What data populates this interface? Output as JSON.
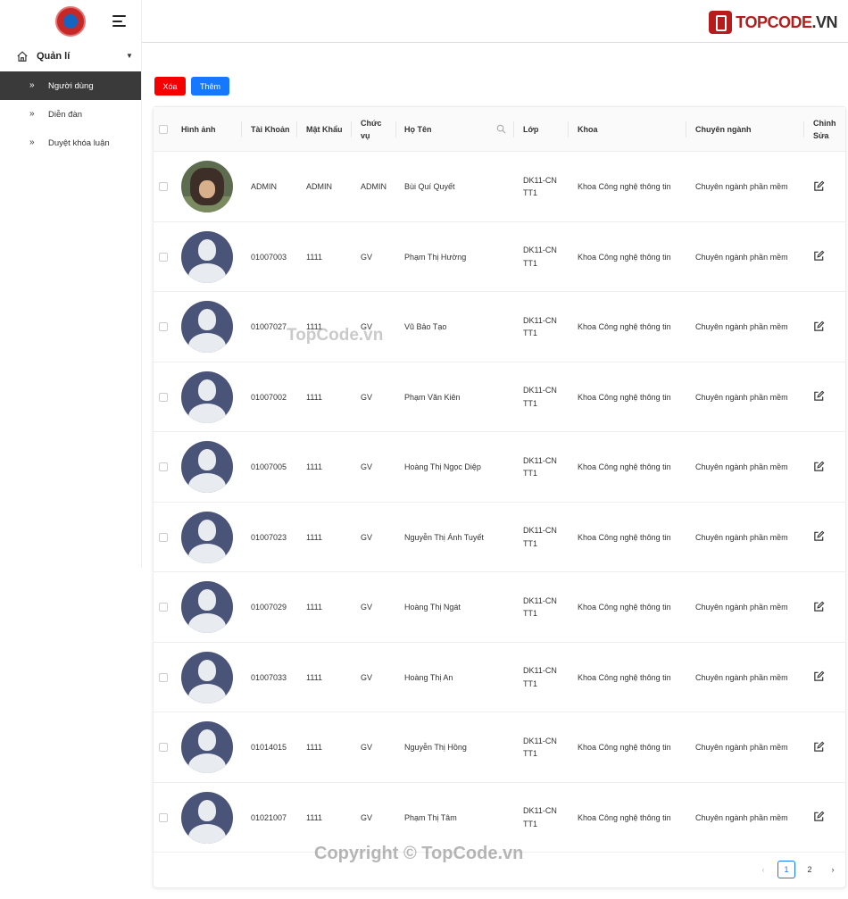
{
  "sidebar": {
    "group_label": "Quản lí",
    "items": [
      {
        "label": "Người dùng",
        "active": true
      },
      {
        "label": "Diễn đàn",
        "active": false
      },
      {
        "label": "Duyệt khóa luận",
        "active": false
      }
    ]
  },
  "brand": {
    "name": "TOPCODE",
    "suffix": ".VN"
  },
  "toolbar": {
    "delete_label": "Xóa",
    "add_label": "Thêm"
  },
  "table": {
    "headers": [
      "Hình ảnh",
      "Tài Khoản",
      "Mật Khẩu",
      "Chức vụ",
      "Họ Tên",
      "Lớp",
      "Khoa",
      "Chuyên ngành",
      "Chỉnh Sửa"
    ],
    "rows": [
      {
        "avatar": "photo",
        "account": "ADMIN",
        "password": "ADMIN",
        "role": "ADMIN",
        "name": "Bùi Quí Quyết",
        "class": "DK11-CNTT1",
        "faculty": "Khoa Công nghệ thông tin",
        "major": "Chuyên ngành phần mềm"
      },
      {
        "avatar": "default",
        "account": "01007003",
        "password": "1111",
        "role": "GV",
        "name": "Phạm Thị Hường",
        "class": "DK11-CNTT1",
        "faculty": "Khoa Công nghệ thông tin",
        "major": "Chuyên ngành phần mềm"
      },
      {
        "avatar": "default",
        "account": "01007027",
        "password": "1111",
        "role": "GV",
        "name": "Vũ Bảo Tạo",
        "class": "DK11-CNTT1",
        "faculty": "Khoa Công nghệ thông tin",
        "major": "Chuyên ngành phần mềm"
      },
      {
        "avatar": "default",
        "account": "01007002",
        "password": "1111",
        "role": "GV",
        "name": "Phạm Văn Kiên",
        "class": "DK11-CNTT1",
        "faculty": "Khoa Công nghệ thông tin",
        "major": "Chuyên ngành phần mềm"
      },
      {
        "avatar": "default",
        "account": "01007005",
        "password": "1111",
        "role": "GV",
        "name": "Hoàng Thị Ngọc Diệp",
        "class": "DK11-CNTT1",
        "faculty": "Khoa Công nghệ thông tin",
        "major": "Chuyên ngành phần mềm"
      },
      {
        "avatar": "default",
        "account": "01007023",
        "password": "1111",
        "role": "GV",
        "name": "Nguyễn Thị Ánh Tuyết",
        "class": "DK11-CNTT1",
        "faculty": "Khoa Công nghệ thông tin",
        "major": "Chuyên ngành phần mềm"
      },
      {
        "avatar": "default",
        "account": "01007029",
        "password": "1111",
        "role": "GV",
        "name": "Hoàng Thị Ngát",
        "class": "DK11-CNTT1",
        "faculty": "Khoa Công nghệ thông tin",
        "major": "Chuyên ngành phần mềm"
      },
      {
        "avatar": "default",
        "account": "01007033",
        "password": "1111",
        "role": "GV",
        "name": "Hoàng Thị An",
        "class": "DK11-CNTT1",
        "faculty": "Khoa Công nghệ thông tin",
        "major": "Chuyên ngành phần mềm"
      },
      {
        "avatar": "default",
        "account": "01014015",
        "password": "1111",
        "role": "GV",
        "name": "Nguyễn Thị Hồng",
        "class": "DK11-CNTT1",
        "faculty": "Khoa Công nghệ thông tin",
        "major": "Chuyên ngành phần mềm"
      },
      {
        "avatar": "default",
        "account": "01021007",
        "password": "1111",
        "role": "GV",
        "name": "Phạm Thị Tâm",
        "class": "DK11-CNTT1",
        "faculty": "Khoa Công nghệ thông tin",
        "major": "Chuyên ngành phần mềm"
      }
    ]
  },
  "pagination": {
    "pages": [
      "1",
      "2"
    ],
    "current": "1"
  },
  "watermarks": {
    "mid": "TopCode.vn",
    "bottom": "Copyright © TopCode.vn"
  },
  "colors": {
    "danger": "#f40000",
    "primary": "#1677ff",
    "sidebar_active": "#3a3a3a",
    "brand": "#b71c1c"
  }
}
